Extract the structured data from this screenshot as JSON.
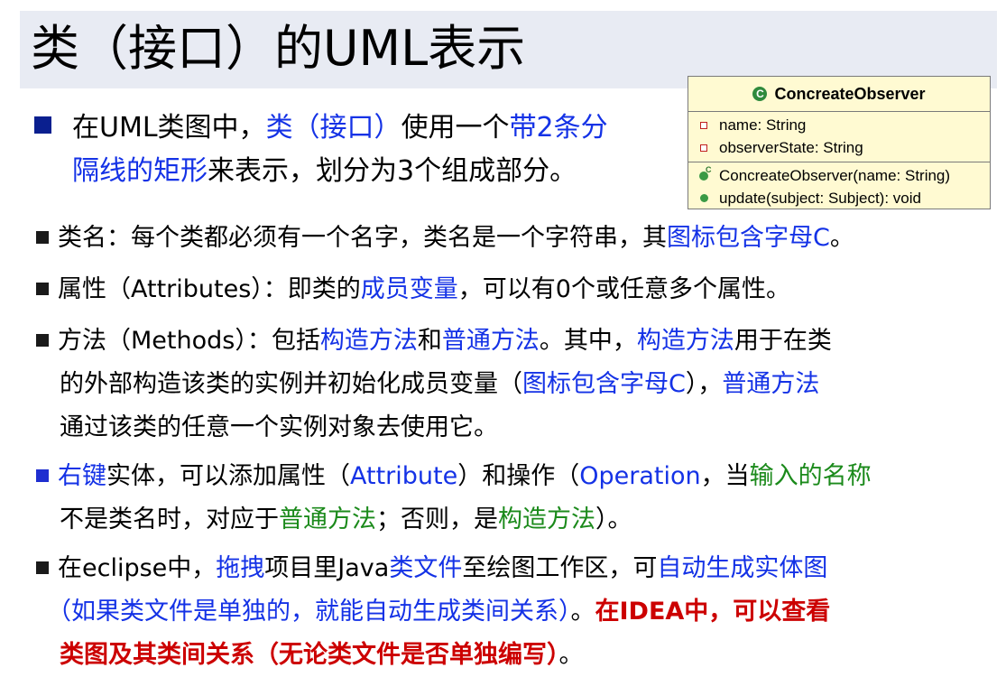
{
  "title": "类（接口）的UML表示",
  "uml": {
    "class_name": "ConcreateObserver",
    "attributes": [
      "name: String",
      "observerState: String"
    ],
    "constructor": "ConcreateObserver(name: String)",
    "method": "update(subject: Subject): void",
    "icons": {
      "class": "class-c-icon",
      "attribute": "private-field-icon",
      "constructor": "constructor-icon",
      "method": "public-method-icon"
    },
    "colors": {
      "background": "#fffad2",
      "class_icon": "#2f8a3c",
      "field_icon": "#c02020"
    }
  },
  "intro": {
    "t1": "在UML类图中，",
    "t2": "类（接口）",
    "t3": "使用一个",
    "t4": "带2条分",
    "t5": "隔线的矩形",
    "t6": "来表示，划分为3个组成部分。"
  },
  "classname_item": {
    "t1": "类名：每个类都必须有一个名字，类名是一个字符串，其",
    "t2": "图标包含字母C",
    "t3": "。"
  },
  "attr_item": {
    "t1": "属性（Attributes）：即类的",
    "t2": "成员变量",
    "t3": "，可以有0个或任意多个属性。"
  },
  "method_item": {
    "t1": "方法（Methods）：包括",
    "t2": "构造方法",
    "t3": "和",
    "t4": "普通方法",
    "t5": "。其中，",
    "t6": "构造方法",
    "t7": "用于在类",
    "t8": "的外部构造该类的实例并初始化成员变量（",
    "t9": "图标包含字母C",
    "t10": "），",
    "t11": "普通方法",
    "t12": "通过该类的任意一个实例对象去使用它。"
  },
  "rightclick_item": {
    "t1": "右键",
    "t2": "实体，可以添加属性（",
    "t3": "Attribute",
    "t4": "）和操作（",
    "t5": "Operation",
    "t6": "，当",
    "t7": "输入的名称",
    "t8": "不是类名时，对应于",
    "t9": "普通方法",
    "t10": "；否则，是",
    "t11": "构造方法",
    "t12": "）。"
  },
  "eclipse_item": {
    "t1": "在eclipse中，",
    "t2": "拖拽",
    "t3": "项目里Java",
    "t4": "类文件",
    "t5": "至绘图工作区，可",
    "t6": "自动生成实体图",
    "t7": "（如果类文件是单独的，就能自动生成类间关系）",
    "t8": "。",
    "t9": "在IDEA中，可以查看",
    "t10": "类图及其类间关系（无论类文件是否单独编写）",
    "t11": "。"
  }
}
